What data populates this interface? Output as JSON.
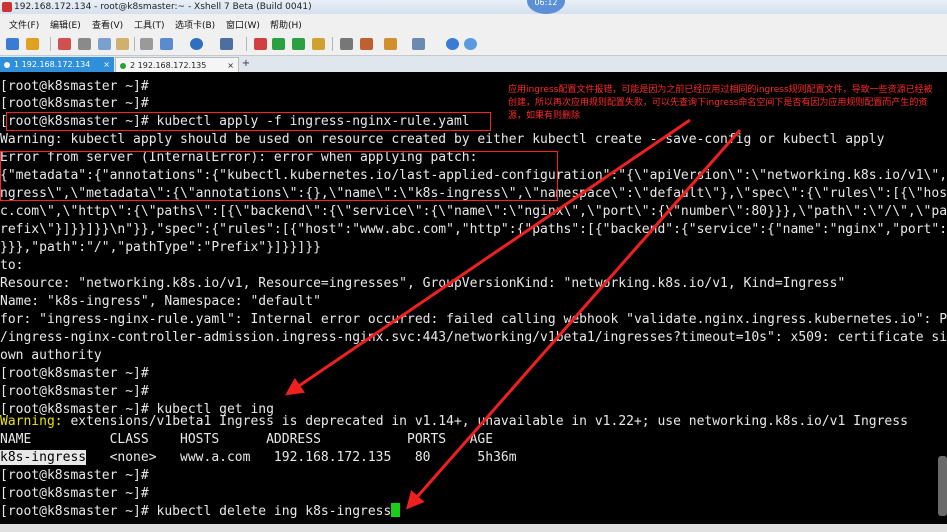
{
  "window": {
    "title": "192.168.172.134 - root@k8smaster:~ - Xshell 7 Beta (Build 0041)",
    "clock": "06:12"
  },
  "menu": [
    "文件(F)",
    "编辑(E)",
    "查看(V)",
    "工具(T)",
    "选项卡(B)",
    "窗口(W)",
    "帮助(H)"
  ],
  "toolbar_icons": [
    "new-session-icon",
    "open-folder-icon",
    "reconnect-icon",
    "disconnect-icon",
    "copy-icon",
    "paste-icon",
    "find-icon",
    "zoom-icon",
    "globe-icon",
    "font-icon",
    "color-icon",
    "xftp-icon",
    "fullscreen-icon",
    "lock-icon",
    "keyboard-icon",
    "script-icon",
    "compose-icon",
    "layout-icon",
    "help-icon",
    "info-icon"
  ],
  "tabs": [
    {
      "label": "1 192.168.172.134",
      "active": true,
      "close": "×"
    },
    {
      "label": "2 192.168.172.135",
      "active": false,
      "close": "×"
    }
  ],
  "add_tab": "+",
  "terminal": {
    "lines": [
      "[root@k8smaster ~]#",
      "[root@k8smaster ~]#",
      "[root@k8smaster ~]# kubectl apply -f ingress-nginx-rule.yaml",
      "Warning: kubectl apply should be used on resource created by either kubectl create --save-config or kubectl apply",
      "Error from server (InternalError): error when applying patch:",
      "{\"metadata\":{\"annotations\":{\"kubectl.kubernetes.io/last-applied-configuration\":\"{\\\"apiVersion\\\":\\\"networking.k8s.io/v1\\\",\\\"kind\\\":\\\"Ingress\\\"",
      "ngress\\\",\\\"metadata\\\":{\\\"annotations\\\":{},\\\"name\\\":\\\"k8s-ingress\\\",\\\"namespace\\\":\\\"default\\\"},\\\"spec\\\":{\\\"rules\\\":[{\\\"host\\\":\\\"www.ab",
      "c.com\\\",\\\"http\\\":{\\\"paths\\\":[{\\\"backend\\\":{\\\"service\\\":{\\\"name\\\":\\\"nginx\\\",\\\"port\\\":{\\\"number\\\":80}}},\\\"path\\\":\\\"/\\\",\\\"pathType\\\":\\\"P",
      "refix\\\"}]}}]}}\\n\"}},\"spec\":{\"rules\":[{\"host\":\"www.abc.com\",\"http\":{\"paths\":[{\"backend\":{\"service\":{\"name\":\"nginx\",\"port\":{\"number\":80}",
      "}}},\"path\":\"/\",\"pathType\":\"Prefix\"}]}}]}}",
      "to:",
      "Resource: \"networking.k8s.io/v1, Resource=ingresses\", GroupVersionKind: \"networking.k8s.io/v1, Kind=Ingress\"",
      "Name: \"k8s-ingress\", Namespace: \"default\"",
      "for: \"ingress-nginx-rule.yaml\": Internal error occurred: failed calling webhook \"validate.nginx.ingress.kubernetes.io\": Post \"https://ingress-nginx",
      "/ingress-nginx-controller-admission.ingress-nginx.svc:443/networking/v1beta1/ingresses?timeout=10s\": x509: certificate signed by unkn",
      "own authority",
      "[root@k8smaster ~]#",
      "[root@k8smaster ~]#",
      "[root@k8smaster ~]# kubectl get ing"
    ],
    "warn_label": "Warning:",
    "warn_rest": " extensions/v1beta1 Ingress is deprecated in v1.14+, unavailable in v1.22+; use networking.k8s.io/v1 Ingress",
    "table_header": "NAME          CLASS    HOSTS      ADDRESS           PORTS   AGE",
    "row_name": "k8s-ingress",
    "row_rest": "   <none>   www.a.com   192.168.172.135   80      5h36m",
    "tail_lines": [
      "[root@k8smaster ~]#",
      "[root@k8smaster ~]#"
    ],
    "last_line": "[root@k8smaster ~]# kubectl delete ing k8s-ingress"
  },
  "annotation": "应用ingress配置文件报错，可能是因为之前已经应用过相同的ingress规则配置文件，导致一些资源已经被创建，所以再次应用规则配置失败，可以先查询下ingress命名空间下是否有因为应用规则配置而产生的资源，如果有则删除",
  "colors": {
    "annotation": "#ff2a2a",
    "warning": "#e8e000",
    "cursor": "#17d017",
    "active_tab": "#2f8fd8"
  }
}
